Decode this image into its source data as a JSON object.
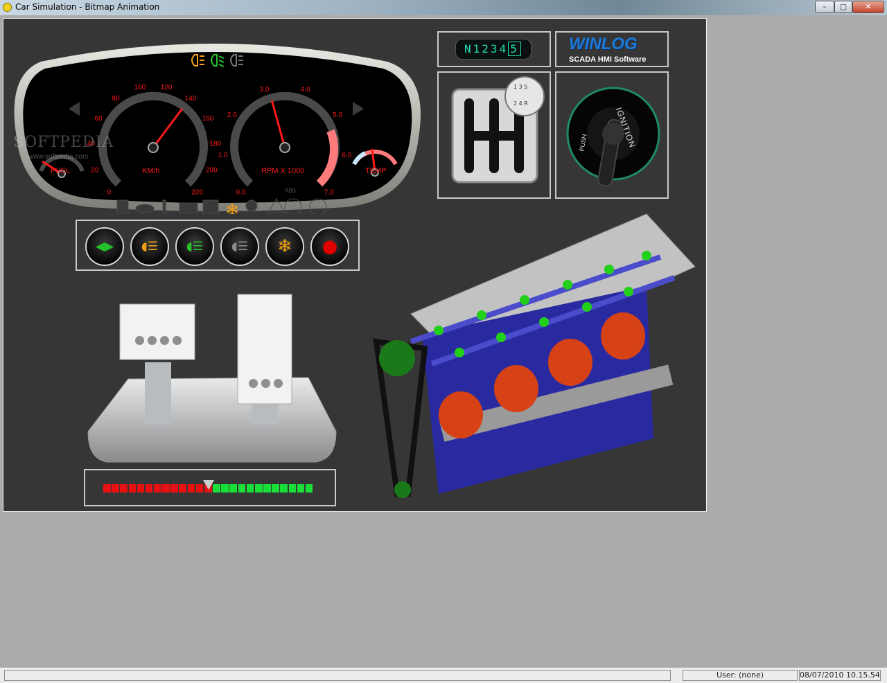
{
  "window": {
    "title": "Car Simulation - Bitmap Animation",
    "minimize": "–",
    "maximize": "▢",
    "close": "✕"
  },
  "dashboard": {
    "speedometer": {
      "ticks": [
        "0",
        "20",
        "40",
        "60",
        "80",
        "100",
        "120",
        "140",
        "160",
        "180",
        "200",
        "220"
      ],
      "unit_label": "KM/h",
      "value": 140
    },
    "tachometer": {
      "ticks": [
        "0.0",
        "1.0",
        "2.0",
        "3.0",
        "4.0",
        "5.0",
        "6.0",
        "7.0"
      ],
      "unit_label": "RPM X 1000",
      "value": 3.1
    },
    "fuel_label": "FUEL",
    "temp_label": "TEMP",
    "watermark": "SOFTPEDIA",
    "watermark_url": "www.softpedia.com",
    "abs_label": "ABS"
  },
  "gear_display": {
    "gears": [
      "N",
      "1",
      "2",
      "3",
      "4"
    ],
    "active_gear": "5"
  },
  "logo": {
    "name": "WINLOG",
    "tagline": "SCADA HMI Software"
  },
  "shifter": {
    "pattern_top": "1 3 5",
    "pattern_bottom": "2 4 R"
  },
  "ignition": {
    "label": "IGNITION",
    "push_label": "PUSH"
  },
  "control_buttons": [
    {
      "name": "turn-signal-button",
      "icon": "double-arrow-icon",
      "color": "#25c42a"
    },
    {
      "name": "fog-light-button",
      "icon": "fog-light-icon",
      "color": "#f2a012"
    },
    {
      "name": "low-beam-button",
      "icon": "low-beam-icon",
      "color": "#25c42a"
    },
    {
      "name": "high-beam-button",
      "icon": "high-beam-icon",
      "color": "#8a8a8a"
    },
    {
      "name": "ac-button",
      "icon": "snowflake-icon",
      "color": "#f2a012"
    },
    {
      "name": "stop-button",
      "icon": "record-icon",
      "color": "#e00000"
    }
  ],
  "throttle_bar": {
    "red_segments": 13,
    "green_segments": 12,
    "position": 0.5
  },
  "status": {
    "user": "User: (none)",
    "datetime": "08/07/2010  10.15.54"
  },
  "colors": {
    "panel_bg": "#363636",
    "gauge_red": "#ff1a1a",
    "green": "#25c42a",
    "orange": "#f2a012"
  }
}
